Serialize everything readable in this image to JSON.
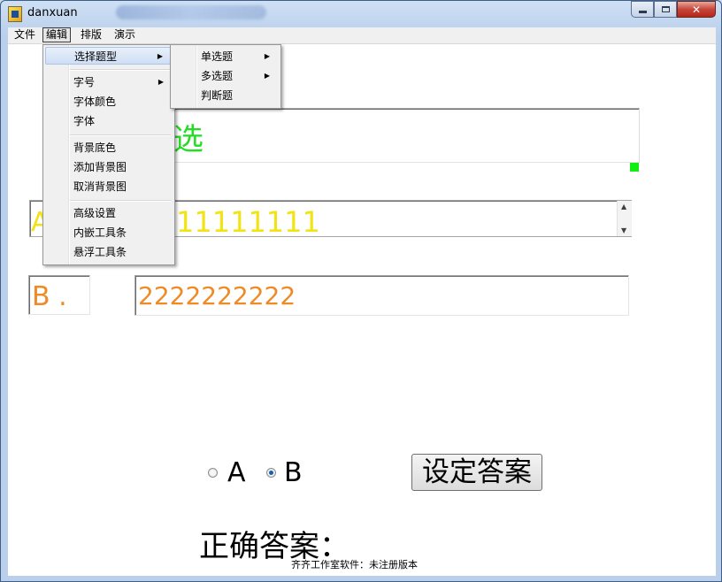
{
  "window": {
    "title": "danxuan"
  },
  "menubar": {
    "items": [
      "文件",
      "编辑",
      "排版",
      "演示"
    ]
  },
  "edit_menu": {
    "items": [
      {
        "label": "选择题型",
        "has_submenu": true
      },
      {
        "label": "字号",
        "has_submenu": true
      },
      {
        "label": "字体颜色"
      },
      {
        "label": "字体"
      },
      {
        "label": "背景底色"
      },
      {
        "label": "添加背景图"
      },
      {
        "label": "取消背景图"
      },
      {
        "label": "高级设置"
      },
      {
        "label": "内嵌工具条"
      },
      {
        "label": "悬浮工具条"
      }
    ]
  },
  "submenu": {
    "items": [
      {
        "label": "单选题",
        "has_submenu": true
      },
      {
        "label": "多选题",
        "has_submenu": true
      },
      {
        "label": "判断题"
      }
    ]
  },
  "question": {
    "text": "选"
  },
  "option_a": {
    "label": "A",
    "text": "11111111"
  },
  "option_b": {
    "label": "B .",
    "text": "2222222222"
  },
  "radios": {
    "a_label": "A",
    "b_label": "B",
    "selected": "B"
  },
  "set_answer_button": "设定答案",
  "answer_label": "正确答案：",
  "footer": "齐齐工作室软件：未注册版本",
  "colors": {
    "question": "#22dd22",
    "option_a": "#f2e314",
    "option_b": "#f08a24",
    "handle": "#11ee11"
  },
  "icons": {
    "close": "✕",
    "scroll_up": "▲",
    "scroll_down": "▼",
    "submenu_arrow": "▶"
  }
}
